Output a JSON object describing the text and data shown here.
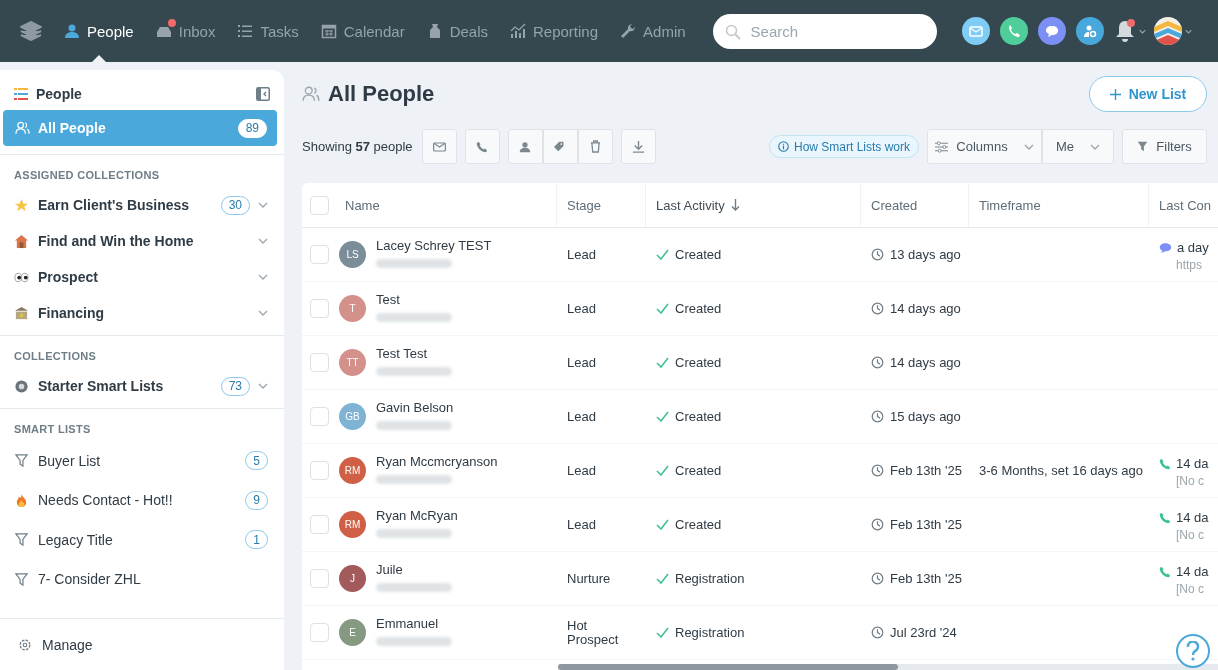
{
  "nav": {
    "items": [
      {
        "label": "People",
        "kind": "person",
        "selected": true,
        "badge": false
      },
      {
        "label": "Inbox",
        "kind": "inbox",
        "selected": false,
        "badge": true
      },
      {
        "label": "Tasks",
        "kind": "list",
        "selected": false,
        "badge": false
      },
      {
        "label": "Calendar",
        "kind": "calendar",
        "selected": false,
        "badge": false
      },
      {
        "label": "Deals",
        "kind": "bag",
        "selected": false,
        "badge": false
      },
      {
        "label": "Reporting",
        "kind": "chart",
        "selected": false,
        "badge": false
      },
      {
        "label": "Admin",
        "kind": "wrench",
        "selected": false,
        "badge": false
      }
    ],
    "search": {
      "placeholder": "Search"
    },
    "actions": [
      {
        "kind": "mail",
        "color": "#7fcdf7"
      },
      {
        "kind": "phone",
        "color": "#4fce9a"
      },
      {
        "kind": "chat",
        "color": "#7b8ff5"
      },
      {
        "kind": "agent",
        "color": "#48a8dc"
      }
    ],
    "notifications": {
      "unread": true
    }
  },
  "sidebar": {
    "title": "People",
    "active": {
      "label": "All People",
      "count": "89",
      "selected": true
    },
    "sections": [
      {
        "heading": "ASSIGNED COLLECTIONS",
        "items": [
          {
            "label": "Earn Client's Business",
            "kind": "star",
            "count": "30"
          },
          {
            "label": "Find and Win the Home",
            "kind": "house"
          },
          {
            "label": "Prospect",
            "kind": "eyes"
          },
          {
            "label": "Financing",
            "kind": "bank"
          }
        ]
      },
      {
        "heading": "COLLECTIONS",
        "items": [
          {
            "label": "Starter Smart Lists",
            "kind": "gear",
            "count": "73"
          }
        ]
      }
    ],
    "smart_lists": {
      "heading": "SMART LISTS",
      "items": [
        {
          "label": "Buyer List",
          "kind": "filter",
          "count": "5"
        },
        {
          "label": "Needs Contact - Hot!!",
          "kind": "fire",
          "count": "9"
        },
        {
          "label": "Legacy Title",
          "kind": "filter",
          "count": "1"
        },
        {
          "label": "7- Consider ZHL",
          "kind": "filter"
        }
      ]
    },
    "manage": "Manage"
  },
  "main": {
    "title": "All People",
    "new_list": "New List",
    "showing": "Showing **57** people",
    "help_link": "How Smart Lists work",
    "columns_button": "Columns",
    "owner_button": "Me",
    "filters_button": "Filters",
    "table": {
      "select_all": {
        "checked": false
      },
      "columns": [
        {
          "label": "Name",
          "sorted": false
        },
        {
          "label": "Stage",
          "sorted": false
        },
        {
          "label": "Last Activity",
          "sorted": true
        },
        {
          "label": "Created",
          "sorted": false
        },
        {
          "label": "Timeframe",
          "sorted": false
        },
        {
          "label": "Last Con",
          "sorted": false
        }
      ],
      "rows": [
        {
          "checked": false,
          "initials": "LS",
          "color": "#7a8d99",
          "name": "Lacey Schrey TEST",
          "stage": "Lead",
          "activity": "Created",
          "created": "13 days ago",
          "contact": {
            "kind": "text",
            "line1": "a day",
            "line2": "https"
          }
        },
        {
          "checked": false,
          "initials": "T",
          "color": "#d4908a",
          "name": "Test",
          "stage": "Lead",
          "activity": "Created",
          "created": "14 days ago"
        },
        {
          "checked": false,
          "initials": "TT",
          "color": "#d4908a",
          "name": "Test Test",
          "stage": "Lead",
          "activity": "Created",
          "created": "14 days ago"
        },
        {
          "checked": false,
          "initials": "GB",
          "color": "#7fb3d3",
          "name": "Gavin Belson",
          "stage": "Lead",
          "activity": "Created",
          "created": "15 days ago"
        },
        {
          "checked": false,
          "initials": "RM",
          "color": "#cf6046",
          "name": "Ryan Mccmcryanson",
          "stage": "Lead",
          "activity": "Created",
          "created": "Feb 13th '25",
          "timeframe": "3-6 Months, set 16 days ago",
          "contact": {
            "kind": "call",
            "line1": "14 da",
            "line2": "[No c"
          }
        },
        {
          "checked": false,
          "initials": "RM",
          "color": "#cf6046",
          "name": "Ryan McRyan",
          "stage": "Lead",
          "activity": "Created",
          "created": "Feb 13th '25",
          "contact": {
            "kind": "call",
            "line1": "14 da",
            "line2": "[No c"
          }
        },
        {
          "checked": false,
          "initials": "J",
          "color": "#a35a5a",
          "name": "Juile",
          "stage": "Nurture",
          "activity": "Registration",
          "created": "Feb 13th '25",
          "contact": {
            "kind": "call",
            "line1": "14 da",
            "line2": "[No c"
          }
        },
        {
          "checked": false,
          "initials": "E",
          "color": "#869a82",
          "name": "Emmanuel",
          "stage": "Hot Prospect",
          "activity": "Registration",
          "created": "Jul 23rd '24"
        }
      ]
    }
  }
}
